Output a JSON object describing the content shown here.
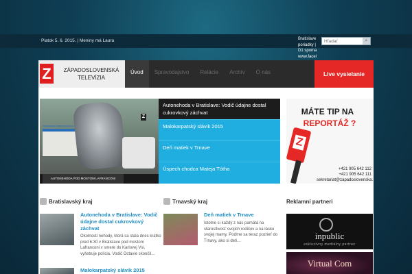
{
  "topbar": {
    "date_text": "Piatok 5. 6. 2015. | Meniny má Laura",
    "ticker_lines": [
      "Bratislave",
      "poriadky |",
      "D1 spoma",
      "www.facel"
    ],
    "search_placeholder": "Hľadať"
  },
  "logo": {
    "letter": "Z",
    "line1": "ZÁPADOSLOVENSKÁ",
    "line2": "TELEVÍZIA"
  },
  "nav": {
    "items": [
      "Úvod",
      "Spravodajstvo",
      "Relácie",
      "Archív",
      "O nás"
    ],
    "live": "Live vysielanie"
  },
  "hero": {
    "caption": "AUTONEHODA POD MOSTOM LAFRANCONI",
    "ambulance_text": "ZÁCHRANNÁ ZDRAVOTNÁ SLUŽBA",
    "badge": "Z",
    "items": [
      "Autonehoda v Bratislave: Vodič údajne dostal cukrovkový záchvat",
      "Malokarpatský slávik 2015",
      "Deň matiek v Trnave",
      "Úspech chodca Mateja Tótha"
    ]
  },
  "tip": {
    "line1": "MÁTE TIP NA",
    "line2": "REPORTÁŽ ?",
    "phone1": "+421 905 642 112",
    "phone2": "+421 905 642 111",
    "email": "sekretariat@zapadoslovenska.sk"
  },
  "sections": {
    "bratislava": {
      "title": "Bratislavský kraj",
      "article1_title": "Autonehoda v Bratislave: Vodič údajne dostal cukrovkový záchvat",
      "article1_text": "Okolnosti nehody, ktorá sa stala dnes krátko pred 6:30 v Bratislave pod mostom Lafranconi v smere do Karlovej Vsi, vyšetruje polícia. Vodič Octavie skončil…",
      "article2_title": "Malokarpatský slávik 2015"
    },
    "trnava": {
      "title": "Trnavský kraj",
      "article1_title": "Deň matiek v Trnave",
      "article1_text": "Istotne si každý z nás pamätá na starostlivosť svojich rodičov a na lásku svojej mamy. Poďme sa teraz pozrieť do Trnavy, ako si deti…"
    },
    "partners": {
      "title": "Reklamní partneri",
      "ad1_name": "inpublic",
      "ad1_sub": "exkluzívny mediálny partner",
      "ad2_name": "Virtual Com"
    }
  }
}
